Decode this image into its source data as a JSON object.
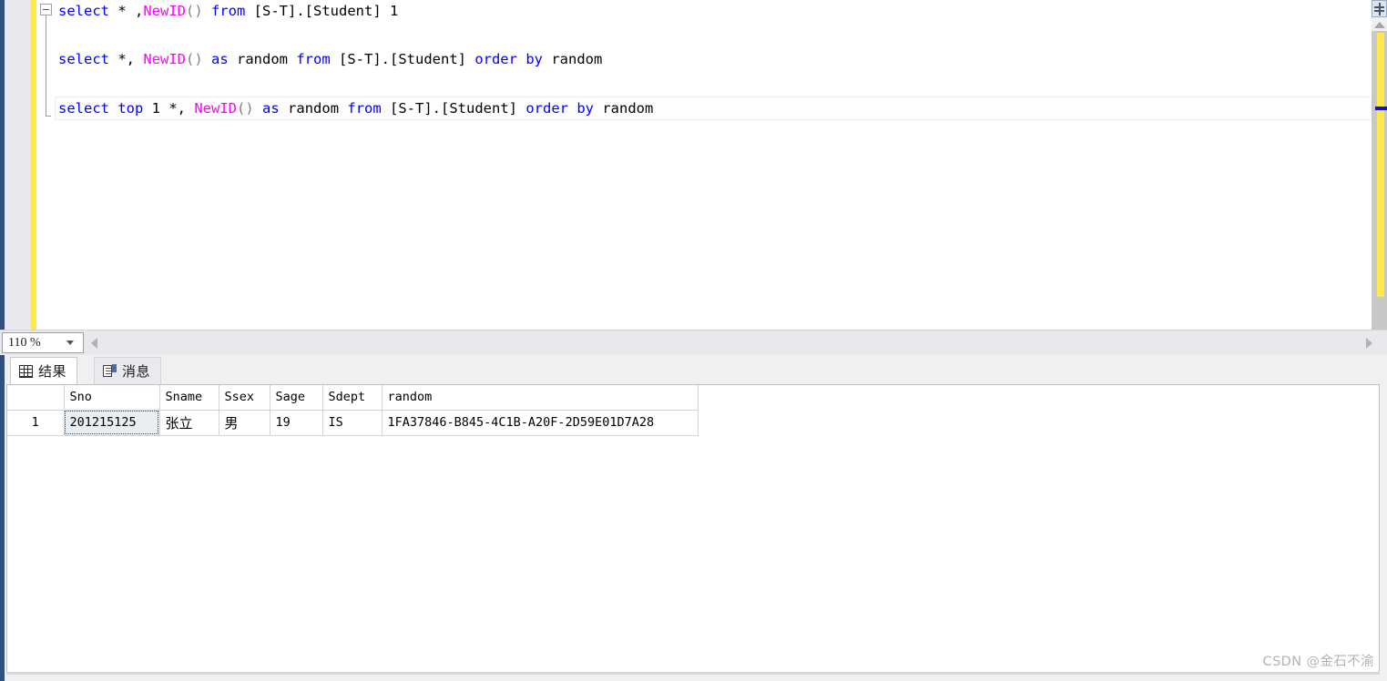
{
  "editor": {
    "zoom_level": "110 %",
    "lines": [
      {
        "id": "line1",
        "tokens": [
          {
            "t": "select",
            "c": "kw"
          },
          {
            "t": " * ,",
            "c": "txt"
          },
          {
            "t": "NewID",
            "c": "fn"
          },
          {
            "t": "()",
            "c": "brk"
          },
          {
            "t": " ",
            "c": "txt"
          },
          {
            "t": "from",
            "c": "kw"
          },
          {
            "t": " [S-T].[Student] 1",
            "c": "txt"
          }
        ],
        "plain": "select * ,NewID() from [S-T].[Student] 1"
      },
      {
        "id": "line2",
        "tokens": [
          {
            "t": "select",
            "c": "kw"
          },
          {
            "t": " *, ",
            "c": "txt"
          },
          {
            "t": "NewID",
            "c": "fn"
          },
          {
            "t": "()",
            "c": "brk"
          },
          {
            "t": " ",
            "c": "txt"
          },
          {
            "t": "as",
            "c": "kw"
          },
          {
            "t": " random ",
            "c": "txt"
          },
          {
            "t": "from",
            "c": "kw"
          },
          {
            "t": " [S-T].[Student] ",
            "c": "txt"
          },
          {
            "t": "order",
            "c": "kw"
          },
          {
            "t": " ",
            "c": "txt"
          },
          {
            "t": "by",
            "c": "kw"
          },
          {
            "t": " random",
            "c": "txt"
          }
        ],
        "plain": "select *, NewID() as random from [S-T].[Student] order by random"
      },
      {
        "id": "line3",
        "tokens": [
          {
            "t": "select",
            "c": "kw"
          },
          {
            "t": " ",
            "c": "txt"
          },
          {
            "t": "top",
            "c": "kw"
          },
          {
            "t": " 1 *, ",
            "c": "txt"
          },
          {
            "t": "NewID",
            "c": "fn"
          },
          {
            "t": "()",
            "c": "brk"
          },
          {
            "t": " ",
            "c": "txt"
          },
          {
            "t": "as",
            "c": "kw"
          },
          {
            "t": " random ",
            "c": "txt"
          },
          {
            "t": "from",
            "c": "kw"
          },
          {
            "t": " [S-T].[Student] ",
            "c": "txt"
          },
          {
            "t": "order",
            "c": "kw"
          },
          {
            "t": " ",
            "c": "txt"
          },
          {
            "t": "by",
            "c": "kw"
          },
          {
            "t": " random",
            "c": "txt"
          }
        ],
        "plain": "select top 1 *, NewID() as random from [S-T].[Student] order by random"
      }
    ]
  },
  "results": {
    "tabs": [
      {
        "label": "结果",
        "icon": "grid-icon",
        "active": true
      },
      {
        "label": "消息",
        "icon": "message-icon",
        "active": false
      }
    ],
    "columns": [
      "Sno",
      "Sname",
      "Ssex",
      "Sage",
      "Sdept",
      "random"
    ],
    "rows": [
      {
        "row_number": "1",
        "cells": [
          "201215125",
          "张立",
          "男",
          "19",
          "IS",
          "1FA37846-B845-4C1B-A20F-2D59E01D7A28"
        ]
      }
    ]
  },
  "watermark": {
    "text": "CSDN @金石不渝"
  },
  "colors": {
    "keyword": "#0000ff",
    "function": "#ff00ff",
    "change_bar": "#ffe84b",
    "accent_edge": "#31507c"
  }
}
